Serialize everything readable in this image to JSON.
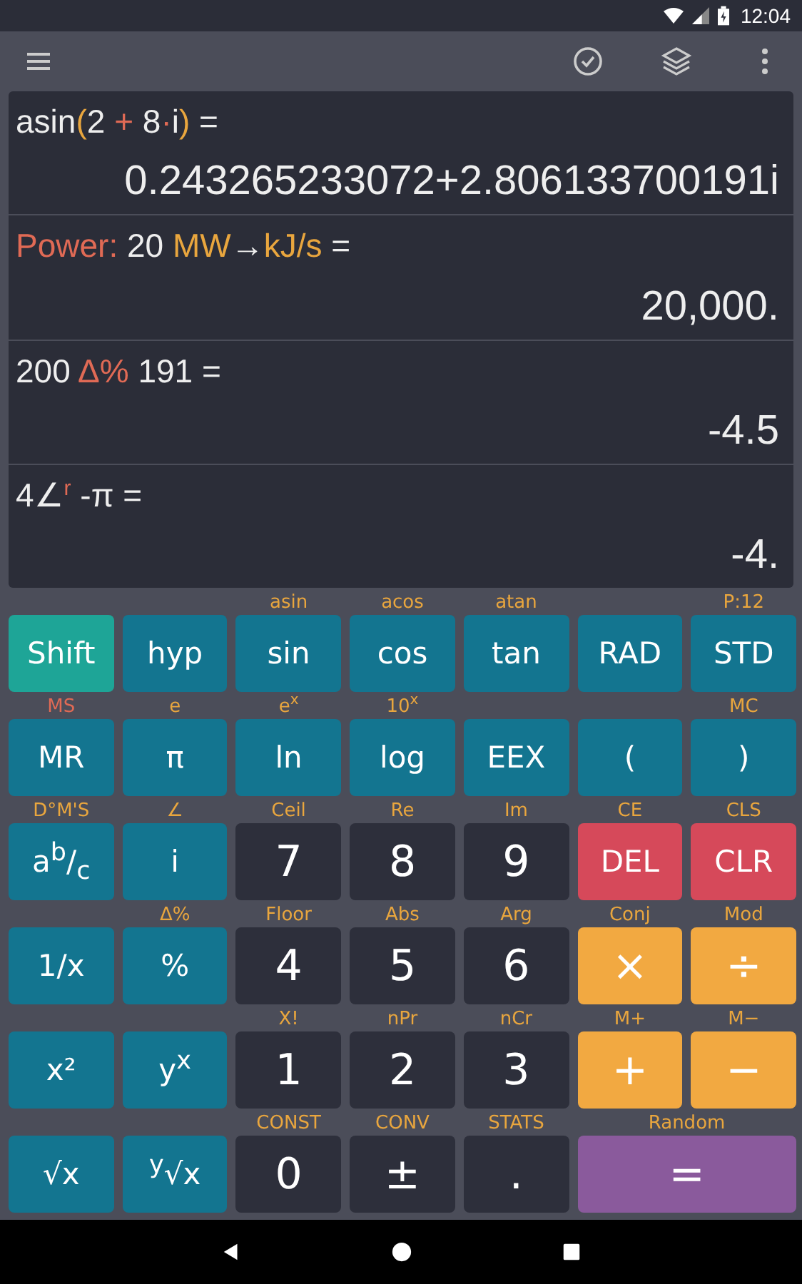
{
  "status_bar": {
    "time": "12:04"
  },
  "history": [
    {
      "expression": [
        {
          "text": "asin",
          "kind": "plain"
        },
        {
          "text": "(",
          "kind": "paren"
        },
        {
          "text": "2 ",
          "kind": "plain"
        },
        {
          "text": "+",
          "kind": "operator"
        },
        {
          "text": " 8",
          "kind": "plain"
        },
        {
          "text": "·",
          "kind": "operator"
        },
        {
          "text": "i",
          "kind": "plain"
        },
        {
          "text": ")",
          "kind": "paren"
        },
        {
          "text": " =",
          "kind": "plain"
        }
      ],
      "result": "0.243265233072+2.806133700191i"
    },
    {
      "expression": [
        {
          "text": "Power:",
          "kind": "category"
        },
        {
          "text": " 20 ",
          "kind": "plain"
        },
        {
          "text": "MW",
          "kind": "unit"
        },
        {
          "text": "→",
          "kind": "plain"
        },
        {
          "text": "kJ/s",
          "kind": "unit"
        },
        {
          "text": " =",
          "kind": "plain"
        }
      ],
      "result": "20,000."
    },
    {
      "expression": [
        {
          "text": "200 ",
          "kind": "plain"
        },
        {
          "text": "Δ%",
          "kind": "operator"
        },
        {
          "text": " 191 =",
          "kind": "plain"
        }
      ],
      "result": "-4.5"
    },
    {
      "expression": [
        {
          "text": "4∠",
          "kind": "plain"
        },
        {
          "text": "r",
          "kind": "superscript"
        },
        {
          "text": " -π =",
          "kind": "plain"
        }
      ],
      "result": "-4."
    }
  ],
  "keys": [
    {
      "label": "Shift",
      "kind": "shift"
    },
    {
      "label": "hyp",
      "kind": "function"
    },
    {
      "shift": "asin",
      "label": "sin",
      "kind": "function"
    },
    {
      "shift": "acos",
      "label": "cos",
      "kind": "function"
    },
    {
      "shift": "atan",
      "label": "tan",
      "kind": "function"
    },
    {
      "label": "RAD",
      "kind": "function"
    },
    {
      "shift": "P:12",
      "label": "STD",
      "kind": "function"
    },
    {
      "shift": "MS",
      "color": "#e06a55",
      "label": "MR",
      "kind": "function"
    },
    {
      "shift": "e",
      "label": "π",
      "kind": "function"
    },
    {
      "shift": "e$^{x}$",
      "label": "ln",
      "kind": "function"
    },
    {
      "shift": "10$^{x}$",
      "label": "log",
      "kind": "function"
    },
    {
      "label": "EEX",
      "kind": "function"
    },
    {
      "label": "(",
      "kind": "function"
    },
    {
      "shift": "MC",
      "label": ")",
      "kind": "function"
    },
    {
      "shift": "D°M'S",
      "label": "a$^{b}$/$_{c}$",
      "kind": "function"
    },
    {
      "shift": "∠",
      "label": "i",
      "kind": "function"
    },
    {
      "shift": "Ceil",
      "label": "7",
      "kind": "digit"
    },
    {
      "shift": "Re",
      "label": "8",
      "kind": "digit"
    },
    {
      "shift": "Im",
      "label": "9",
      "kind": "digit"
    },
    {
      "shift": "CE",
      "label": "DEL",
      "kind": "clear"
    },
    {
      "shift": "CLS",
      "label": "CLR",
      "kind": "clear"
    },
    {
      "label": "1/x",
      "kind": "function"
    },
    {
      "shift": "Δ%",
      "label": "%",
      "kind": "function"
    },
    {
      "shift": "Floor",
      "label": "4",
      "kind": "digit"
    },
    {
      "shift": "Abs",
      "label": "5",
      "kind": "digit"
    },
    {
      "shift": "Arg",
      "label": "6",
      "kind": "digit"
    },
    {
      "shift": "Conj",
      "label": "×",
      "kind": "operator"
    },
    {
      "shift": "Mod",
      "label": "÷",
      "kind": "operator"
    },
    {
      "label": "x²",
      "kind": "function"
    },
    {
      "label": "y$^{x}$",
      "kind": "function"
    },
    {
      "shift": "X!",
      "label": "1",
      "kind": "digit"
    },
    {
      "shift": "nPr",
      "label": "2",
      "kind": "digit"
    },
    {
      "shift": "nCr",
      "label": "3",
      "kind": "digit"
    },
    {
      "shift": "M+",
      "label": "+",
      "kind": "operator"
    },
    {
      "shift": "M−",
      "label": "−",
      "kind": "operator"
    },
    {
      "label": "√x",
      "kind": "function"
    },
    {
      "label": "$^{y}$√x",
      "kind": "function"
    },
    {
      "shift": "CONST",
      "label": "0",
      "kind": "digit"
    },
    {
      "shift": "CONV",
      "label": "±",
      "kind": "digit"
    },
    {
      "shift": "STATS",
      "label": ".",
      "kind": "digit"
    },
    {
      "shift": "Random",
      "label": "=",
      "kind": "equals"
    }
  ]
}
